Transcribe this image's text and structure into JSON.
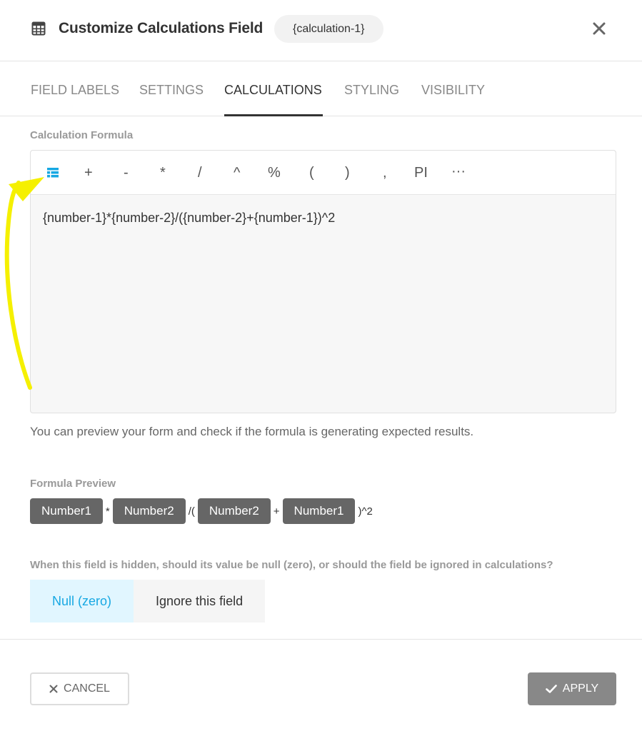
{
  "header": {
    "title": "Customize Calculations Field",
    "tag": "{calculation-1}",
    "icon": "calculator-icon",
    "close_icon": "close-icon"
  },
  "tabs": [
    {
      "label": "FIELD LABELS",
      "active": false
    },
    {
      "label": "SETTINGS",
      "active": false
    },
    {
      "label": "CALCULATIONS",
      "active": true
    },
    {
      "label": "STYLING",
      "active": false
    },
    {
      "label": "VISIBILITY",
      "active": false
    }
  ],
  "formula_section": {
    "label": "Calculation Formula",
    "toolbar": {
      "fields_icon": "table-fields-icon",
      "operators": [
        "+",
        "-",
        "*",
        "/",
        "^",
        "%",
        "(",
        ")",
        ",",
        "PI",
        "···"
      ]
    },
    "formula": "{number-1}*{number-2}/({number-2}+{number-1})^2",
    "hint": "You can preview your form and check if the formula is generating expected results."
  },
  "preview": {
    "label": "Formula Preview",
    "chips": [
      "Number1",
      "Number2",
      "Number2",
      "Number1"
    ],
    "ops": [
      "*",
      "/(",
      "+",
      ")^2"
    ]
  },
  "hidden_behavior": {
    "question": "When this field is hidden, should its value be null (zero), or should the field be ignored in calculations?",
    "options": [
      {
        "label": "Null (zero)",
        "selected": true
      },
      {
        "label": "Ignore this field",
        "selected": false
      }
    ]
  },
  "footer": {
    "cancel_label": "CANCEL",
    "apply_label": "APPLY"
  },
  "colors": {
    "accent": "#17a8e3",
    "selected_bg": "#e1f6ff",
    "chip_bg": "#666666",
    "apply_bg": "#888888",
    "annotation_arrow": "#f5f000"
  }
}
